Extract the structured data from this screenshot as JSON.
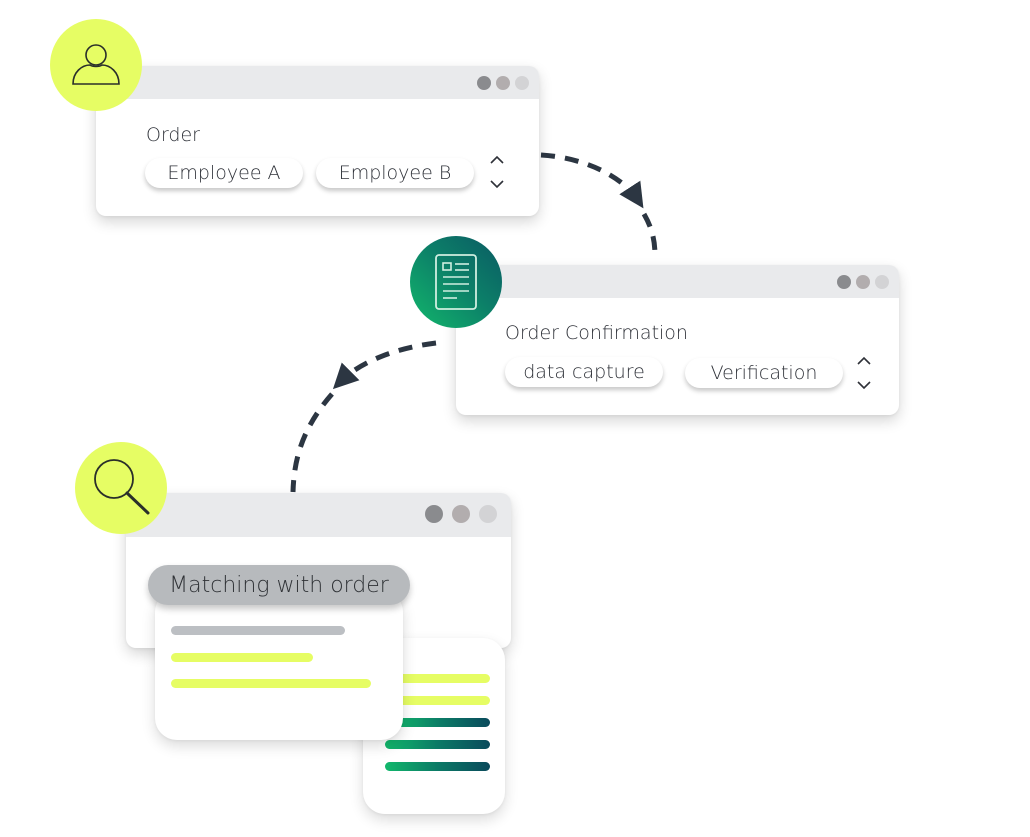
{
  "colors": {
    "accent_lime": "#e6fd64",
    "accent_green_start": "#12b86c",
    "accent_green_end": "#0a4a5c",
    "arrow": "#2c3642",
    "titlebar": "#e9eaec",
    "text": "#2e3138"
  },
  "steps": [
    {
      "icon": "user-icon",
      "title": "Order",
      "options": [
        "Employee A",
        "Employee B"
      ],
      "stepper": {
        "up": "^",
        "down": "v"
      }
    },
    {
      "icon": "document-icon",
      "title": "Order Confirmation",
      "options": [
        "data capture",
        "Verification"
      ],
      "stepper": {
        "up": "^",
        "down": "v"
      }
    },
    {
      "icon": "search-icon",
      "title": "Matching with order"
    }
  ]
}
